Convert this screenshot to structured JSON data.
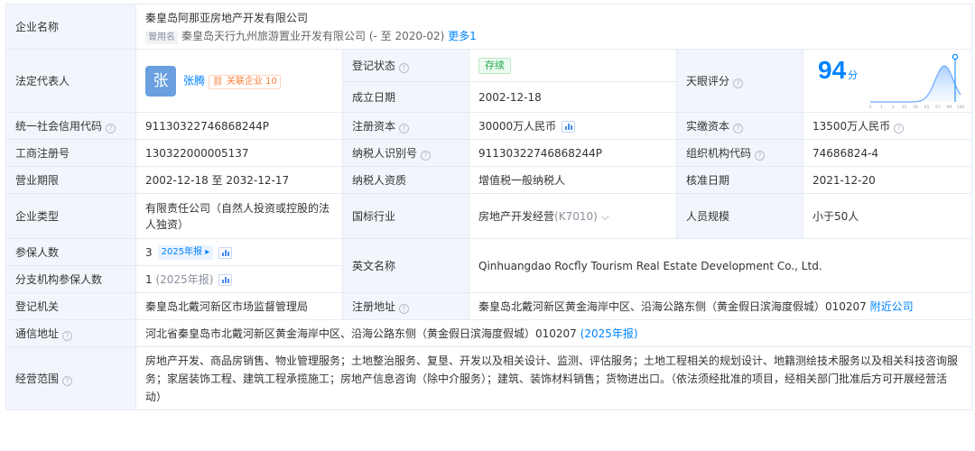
{
  "company": {
    "label": "企业名称",
    "name": "秦皇岛阿那亚房地产开发有限公司",
    "alias_tag": "曾用名",
    "alias": "秦皇岛天行九州旅游置业开发有限公司 (- 至 2020-02)",
    "more_link": "更多1"
  },
  "legal_rep": {
    "label": "法定代表人",
    "avatar_char": "张",
    "name": "张腾",
    "rel_label": "关联企业",
    "rel_count": "10"
  },
  "reg_status": {
    "label": "登记状态",
    "value": "存续"
  },
  "found_date": {
    "label": "成立日期",
    "value": "2002-12-18"
  },
  "score": {
    "label": "天眼评分",
    "value": "94",
    "unit": "分",
    "axis_ticks": [
      "0",
      "1",
      "3",
      "15",
      "30",
      "65",
      "97",
      "99",
      "100"
    ],
    "marker_level": 0.94
  },
  "credit_code": {
    "label": "统一社会信用代码",
    "value": "91130322746868244P"
  },
  "reg_capital": {
    "label": "注册资本",
    "value": "30000万人民币"
  },
  "paid_capital": {
    "label": "实缴资本",
    "value": "13500万人民币"
  },
  "biz_reg_no": {
    "label": "工商注册号",
    "value": "130322000005137"
  },
  "taxpayer_id": {
    "label": "纳税人识别号",
    "value": "91130322746868244P"
  },
  "org_code": {
    "label": "组织机构代码",
    "value": "74686824-4"
  },
  "biz_term": {
    "label": "营业期限",
    "value": "2002-12-18 至 2032-12-17"
  },
  "taxpayer_qual": {
    "label": "纳税人资质",
    "value": "增值税一般纳税人"
  },
  "approval_date": {
    "label": "核准日期",
    "value": "2021-12-20"
  },
  "company_type": {
    "label": "企业类型",
    "value": "有限责任公司（自然人投资或控股的法人独资）"
  },
  "industry": {
    "label": "国标行业",
    "value": "房地产开发经营",
    "code": "(K7010)"
  },
  "staff_size": {
    "label": "人员规模",
    "value": "小于50人"
  },
  "insured": {
    "label": "参保人数",
    "value": "3",
    "year_tag": "2025年报"
  },
  "branch_insured": {
    "label": "分支机构参保人数",
    "value": "1",
    "year": "(2025年报)"
  },
  "english_name": {
    "label": "英文名称",
    "value": "Qinhuangdao Rocfly Tourism Real Estate Development Co., Ltd."
  },
  "reg_authority": {
    "label": "登记机关",
    "value": "秦皇岛北戴河新区市场监督管理局"
  },
  "reg_address": {
    "label": "注册地址",
    "value": "秦皇岛北戴河新区黄金海岸中区、沿海公路东侧（黄金假日滨海度假城）010207",
    "link": "附近公司"
  },
  "mail_address": {
    "label": "通信地址",
    "value": "河北省秦皇岛市北戴河新区黄金海岸中区、沿海公路东侧（黄金假日滨海度假城）010207",
    "link": "(2025年报)"
  },
  "biz_scope": {
    "label": "经营范围",
    "value": "房地产开发、商品房销售、物业管理服务；土地整治服务、复垦、开发以及相关设计、监测、评估服务；土地工程相关的规划设计、地籍测绘技术服务以及相关科技咨询服务；家居装饰工程、建筑工程承揽施工；房地产信息咨询（除中介服务）；建筑、装饰材料销售；货物进出口。（依法须经批准的项目，经相关部门批准后方可开展经营活动）"
  },
  "colors": {
    "accent": "#0084ff",
    "label_bg": "#f2f6fc",
    "border": "#e5eaf3",
    "status_green": "#1fa94a",
    "badge_orange": "#ff7a33"
  }
}
